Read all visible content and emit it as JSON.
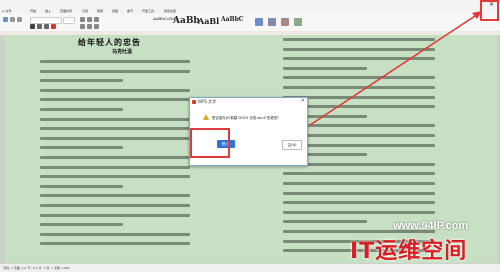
{
  "menu": {
    "items": [
      "≡ 文件",
      "开始",
      "插入",
      "页面布局",
      "引用",
      "审阅",
      "视图",
      "章节",
      "开发工具",
      "特色功能"
    ]
  },
  "ribbon": {
    "style_samples": [
      "AaBbCcDd",
      "AaBb",
      "AaBl",
      "AaBbC"
    ]
  },
  "document": {
    "title": "给年轻人的忠告",
    "author": "马克吐温"
  },
  "dialog": {
    "title": "WPS 文字",
    "message": "是否保存对\"新建 DOCX 文档.docx\"的更改?",
    "yes_label": "是(Y)",
    "no_label": "否(N)"
  },
  "status": {
    "text": "页码: 1  页面: 1/2  节: 1/1  行: 1  列: 1  字数: 1960"
  },
  "watermark": {
    "url": "www.94IP.com",
    "brand": "IT运维空间"
  },
  "colors": {
    "accent": "#2e74d8",
    "annotation": "#e03a3a",
    "page_bg": "#c7e0c3"
  }
}
